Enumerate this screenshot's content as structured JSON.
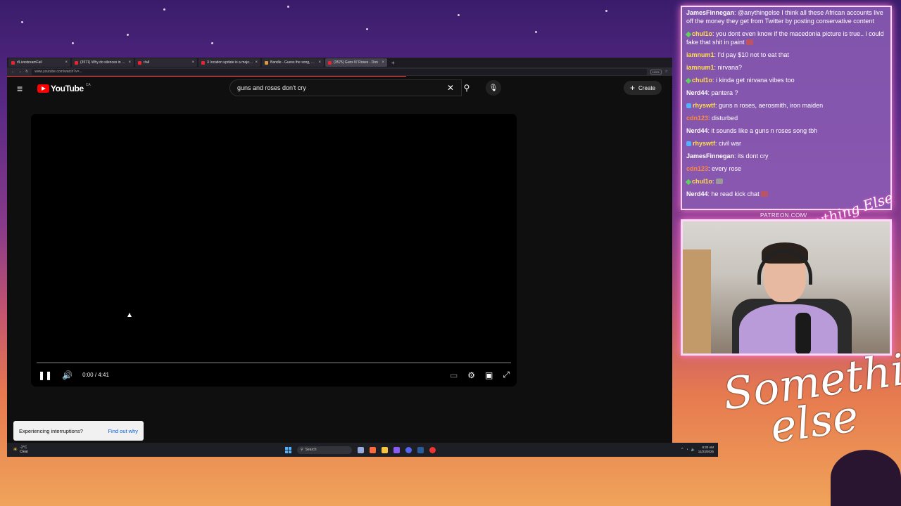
{
  "browser": {
    "tabs": [
      {
        "title": "r/LivestreamFail",
        "active": false
      },
      {
        "title": "(3571) Why do silences in mo",
        "active": false
      },
      {
        "title": "r/all",
        "active": false
      },
      {
        "title": "X location update is a major so",
        "active": false
      },
      {
        "title": "Bandle - Guess the song, one in",
        "active": false
      },
      {
        "title": "(3575) Guns N' Roses - Don",
        "active": true
      }
    ],
    "url": "www.youtube.com/watch?v=...",
    "zoom": "110%"
  },
  "youtube": {
    "logo_text": "YouTube",
    "region": "CA",
    "search_value": "guns and roses don't cry",
    "create_label": "Create",
    "player": {
      "time_current": "0:00",
      "time_total": "4:41",
      "time_separator": "/",
      "progress": 0.0
    },
    "toast": {
      "message": "Experiencing interruptions?",
      "link": "Find out why"
    }
  },
  "taskbar": {
    "weather_temp": "-2°C",
    "weather_desc": "Clear",
    "search_label": "Search",
    "time": "8:30 AM",
    "date": "11/23/2025"
  },
  "chat": {
    "messages": [
      {
        "user": "JamesFinnegan",
        "color": "#ffffff",
        "badge": "",
        "text": "@anythingelse I think all these African accounts live off the money they get from Twitter by posting conservative content"
      },
      {
        "user": "chul1o",
        "color": "#ffe04a",
        "badge": "green",
        "text": "you dont even know if the macedonia picture is true.. i could fake that shit in paint"
      },
      {
        "user": "iamnum1",
        "color": "#ffe04a",
        "badge": "",
        "text": "I'd pay $10 not to eat that"
      },
      {
        "user": "iamnum1",
        "color": "#ffe04a",
        "badge": "",
        "text": "nirvana?"
      },
      {
        "user": "chul1o",
        "color": "#ffe04a",
        "badge": "green",
        "text": "i kinda get nirvana vibes too"
      },
      {
        "user": "Nerd44",
        "color": "#ffffff",
        "badge": "",
        "text": "pantera ?"
      },
      {
        "user": "rhyswtf",
        "color": "#ffe04a",
        "badge": "blue",
        "text": "guns n roses, aerosmith, iron maiden"
      },
      {
        "user": "cdn123",
        "color": "#ff8a3a",
        "badge": "",
        "text": "disturbed"
      },
      {
        "user": "Nerd44",
        "color": "#ffffff",
        "badge": "",
        "text": "it sounds like a guns n roses song tbh"
      },
      {
        "user": "rhyswtf",
        "color": "#ffe04a",
        "badge": "blue",
        "text": "civil war"
      },
      {
        "user": "JamesFinnegan",
        "color": "#ffffff",
        "badge": "",
        "text": "its dont cry"
      },
      {
        "user": "cdn123",
        "color": "#ff8a3a",
        "badge": "",
        "text": "every rose"
      },
      {
        "user": "chul1o",
        "color": "#ffe04a",
        "badge": "green",
        "text": ""
      },
      {
        "user": "Nerd44",
        "color": "#ffffff",
        "badge": "",
        "text": "he read kick chat"
      }
    ]
  },
  "overlay": {
    "patreon": "PATREON.COM/",
    "signature_small": "Anything Else",
    "signature_large_line1": "Something",
    "signature_large_line2": "else"
  }
}
